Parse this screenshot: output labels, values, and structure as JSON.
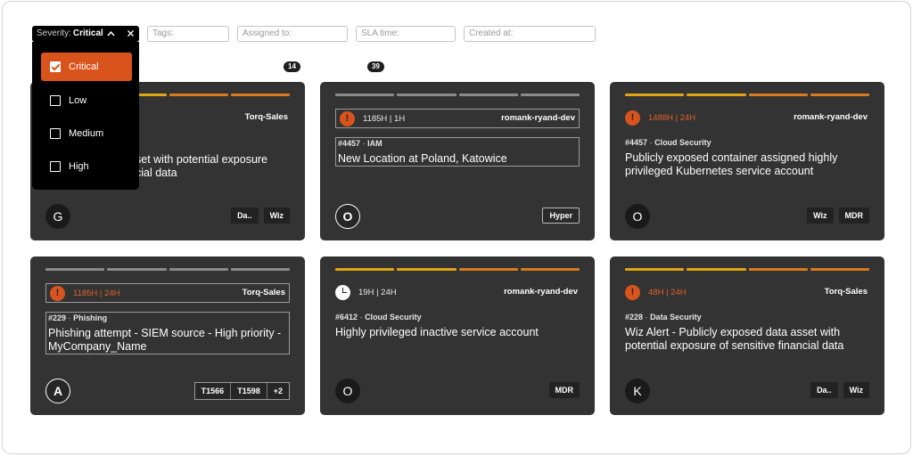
{
  "filters": {
    "severity_label": "Severity:",
    "severity_value": "Critical",
    "tags_placeholder": "Tags:",
    "assigned_placeholder": "Assigned to:",
    "sla_placeholder": "SLA time:",
    "created_placeholder": "Created at:"
  },
  "severity_options": [
    "Critical",
    "Low",
    "Medium",
    "High"
  ],
  "selected_option": "Critical",
  "counts": [
    "14",
    "39"
  ],
  "colors": {
    "card_bg": "#333333",
    "accent_orange": "#d9541c",
    "bar_yellow": "#e0a512",
    "bar_orange": "#d97a1c",
    "bar_gray": "#8a8a8a"
  },
  "cards": [
    {
      "sla": "",
      "owner": "Torq-Sales",
      "tag_line": "",
      "title": "Wiz Alert - Publicly exposed data asset with potential exposure of sensitive financial data",
      "visible_title_lines": [
        "set with potential exposure",
        "cial data"
      ],
      "avatar": "G",
      "chips": [
        "Da..",
        "Wiz"
      ]
    },
    {
      "sla": "1185H | 1H",
      "owner": "romank-ryand-dev",
      "tag_line_id": "#4457",
      "tag_line_cat": "IAM",
      "title": "New Location at Poland, Katowice",
      "avatar": "O",
      "chips": [
        "Hyper"
      ]
    },
    {
      "sla": "1488H | 24H",
      "owner": "romank-ryand-dev",
      "tag_line_id": "#4457",
      "tag_line_cat": "Cloud Security",
      "title": "Publicly exposed container assigned highly privileged Kubernetes service account",
      "avatar": "O",
      "chips": [
        "Wiz",
        "MDR"
      ]
    },
    {
      "sla": "1185H | 24H",
      "owner": "Torq-Sales",
      "tag_line_id": "#229",
      "tag_line_cat": "Phishing",
      "title": "Phishing attempt - SIEM source - High priority - MyCompany_Name",
      "avatar": "A",
      "chips": [
        "T1566",
        "T1598",
        "+2"
      ]
    },
    {
      "sla": "19H | 24H",
      "owner": "romank-ryand-dev",
      "tag_line_id": "#6412",
      "tag_line_cat": "Cloud Security",
      "title": "Highly privileged inactive service account",
      "avatar": "O",
      "chips": [
        "MDR"
      ]
    },
    {
      "sla": "48H | 24H",
      "owner": "Torq-Sales",
      "tag_line_id": "#228",
      "tag_line_cat": "Data Security",
      "title": "Wiz Alert - Publicly exposed data asset with potential exposure of sensitive financial data",
      "avatar": "K",
      "chips": [
        "Da..",
        "Wiz"
      ]
    }
  ],
  "separator": "·"
}
